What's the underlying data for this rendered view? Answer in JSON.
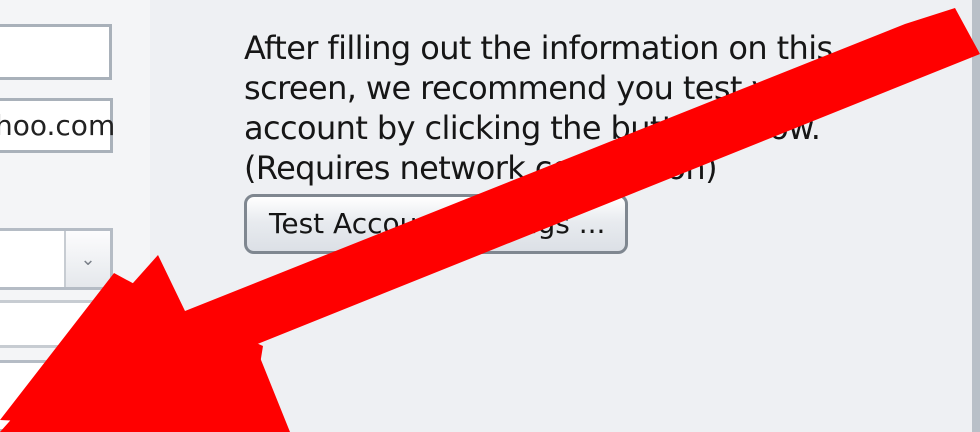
{
  "form": {
    "field_email_value": "hoo.com",
    "dropdown_indicator": "⌄"
  },
  "info": {
    "text": "After filling out the information on this screen, we recommend you test your account by clicking the button below. (Requires network connection)"
  },
  "button": {
    "label": "Test Account Settings ..."
  },
  "annotation": {
    "color": "#ff0000",
    "icon": "arrow-icon"
  }
}
